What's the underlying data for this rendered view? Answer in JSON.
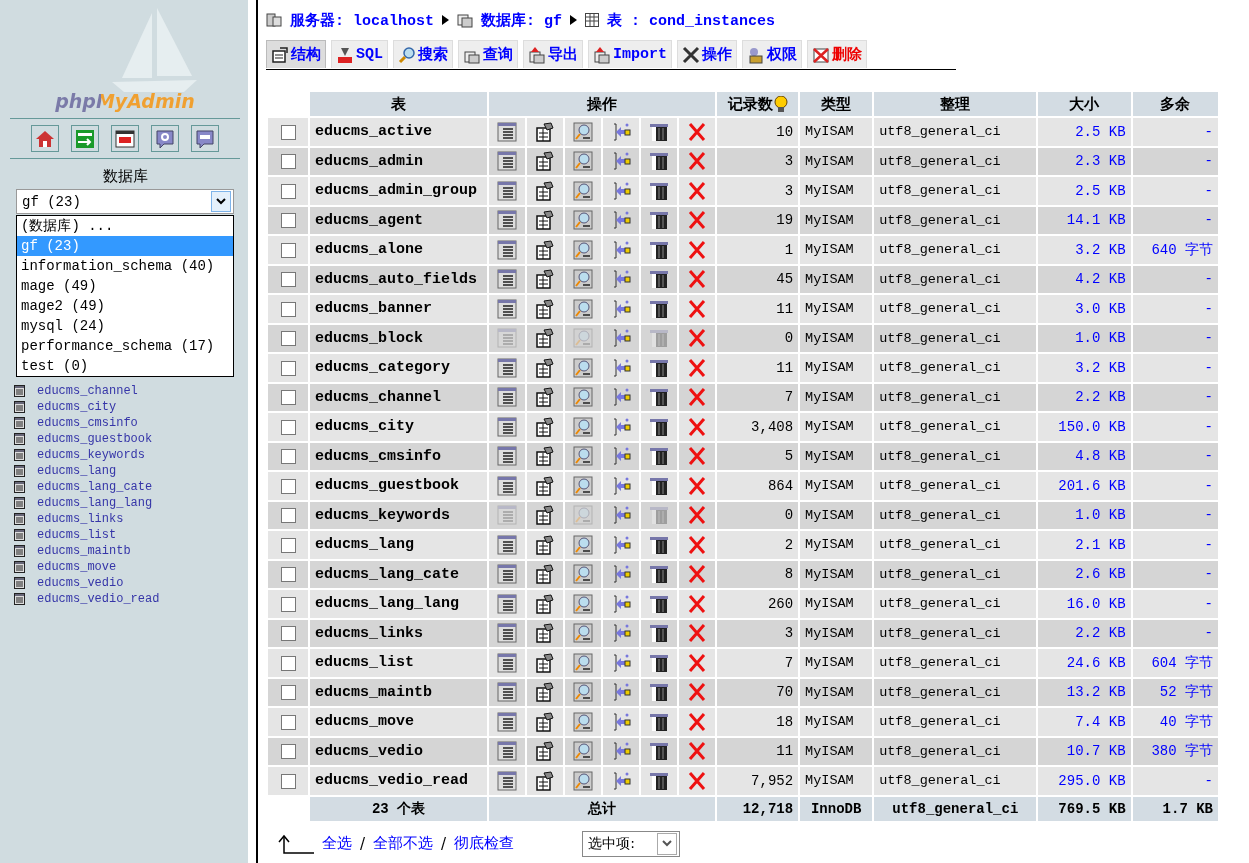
{
  "sidebar": {
    "logo": "phpMyAdmin",
    "toolbar": [
      {
        "kind": "home"
      },
      {
        "kind": "exit"
      },
      {
        "kind": "sql_window"
      },
      {
        "kind": "help"
      },
      {
        "kind": "query"
      }
    ],
    "database_label": "数据库",
    "db_select": {
      "value": "gf (23)",
      "expanded": true,
      "options": [
        {
          "label": "(数据库) ...",
          "selected": false
        },
        {
          "label": "gf (23)",
          "selected": true
        },
        {
          "label": "information_schema (40)",
          "selected": false
        },
        {
          "label": "mage (49)",
          "selected": false
        },
        {
          "label": "mage2 (49)",
          "selected": false
        },
        {
          "label": "mysql (24)",
          "selected": false
        },
        {
          "label": "performance_schema (17)",
          "selected": false
        },
        {
          "label": "test (0)",
          "selected": false
        }
      ]
    },
    "tables": [
      "educms_channel",
      "educms_city",
      "educms_cmsinfo",
      "educms_guestbook",
      "educms_keywords",
      "educms_lang",
      "educms_lang_cate",
      "educms_lang_lang",
      "educms_links",
      "educms_list",
      "educms_maintb",
      "educms_move",
      "educms_vedio",
      "educms_vedio_read"
    ]
  },
  "breadcrumb": [
    {
      "kind": "server",
      "label": "服务器: localhost"
    },
    {
      "kind": "database",
      "label": "数据库: gf"
    },
    {
      "kind": "table",
      "label": "表 : cond_instances"
    }
  ],
  "tabs": [
    {
      "kind": "structure",
      "label": "结构",
      "selected": true
    },
    {
      "kind": "sql",
      "label": "SQL",
      "selected": false
    },
    {
      "kind": "search",
      "label": "搜索",
      "selected": false
    },
    {
      "kind": "query",
      "label": "查询",
      "selected": false
    },
    {
      "kind": "export",
      "label": "导出",
      "selected": false
    },
    {
      "kind": "import",
      "label": "Import",
      "selected": false
    },
    {
      "kind": "operations",
      "label": "操作",
      "selected": false
    },
    {
      "kind": "privileges",
      "label": "权限",
      "selected": false
    },
    {
      "kind": "drop",
      "label": "删除",
      "selected": false
    }
  ],
  "table": {
    "columns": [
      "表",
      "操作",
      "记录数",
      "类型",
      "整理",
      "大小",
      "多余"
    ],
    "rows": [
      {
        "name": "educms_active",
        "checked": false,
        "empty": false,
        "records": "10",
        "type": "MyISAM",
        "collation": "utf8_general_ci",
        "size": "2.5 KB",
        "overhead": "-"
      },
      {
        "name": "educms_admin",
        "checked": false,
        "empty": false,
        "records": "3",
        "type": "MyISAM",
        "collation": "utf8_general_ci",
        "size": "2.3 KB",
        "overhead": "-"
      },
      {
        "name": "educms_admin_group",
        "checked": false,
        "empty": false,
        "records": "3",
        "type": "MyISAM",
        "collation": "utf8_general_ci",
        "size": "2.5 KB",
        "overhead": "-"
      },
      {
        "name": "educms_agent",
        "checked": false,
        "empty": false,
        "records": "19",
        "type": "MyISAM",
        "collation": "utf8_general_ci",
        "size": "14.1 KB",
        "overhead": "-"
      },
      {
        "name": "educms_alone",
        "checked": false,
        "empty": false,
        "records": "1",
        "type": "MyISAM",
        "collation": "utf8_general_ci",
        "size": "3.2 KB",
        "overhead": "640 字节"
      },
      {
        "name": "educms_auto_fields",
        "checked": false,
        "empty": false,
        "records": "45",
        "type": "MyISAM",
        "collation": "utf8_general_ci",
        "size": "4.2 KB",
        "overhead": "-"
      },
      {
        "name": "educms_banner",
        "checked": false,
        "empty": false,
        "records": "11",
        "type": "MyISAM",
        "collation": "utf8_general_ci",
        "size": "3.0 KB",
        "overhead": "-"
      },
      {
        "name": "educms_block",
        "checked": false,
        "empty": true,
        "records": "0",
        "type": "MyISAM",
        "collation": "utf8_general_ci",
        "size": "1.0 KB",
        "overhead": "-"
      },
      {
        "name": "educms_category",
        "checked": false,
        "empty": false,
        "records": "11",
        "type": "MyISAM",
        "collation": "utf8_general_ci",
        "size": "3.2 KB",
        "overhead": "-"
      },
      {
        "name": "educms_channel",
        "checked": false,
        "empty": false,
        "records": "7",
        "type": "MyISAM",
        "collation": "utf8_general_ci",
        "size": "2.2 KB",
        "overhead": "-"
      },
      {
        "name": "educms_city",
        "checked": false,
        "empty": false,
        "records": "3,408",
        "type": "MyISAM",
        "collation": "utf8_general_ci",
        "size": "150.0 KB",
        "overhead": "-"
      },
      {
        "name": "educms_cmsinfo",
        "checked": false,
        "empty": false,
        "records": "5",
        "type": "MyISAM",
        "collation": "utf8_general_ci",
        "size": "4.8 KB",
        "overhead": "-"
      },
      {
        "name": "educms_guestbook",
        "checked": false,
        "empty": false,
        "records": "864",
        "type": "MyISAM",
        "collation": "utf8_general_ci",
        "size": "201.6 KB",
        "overhead": "-"
      },
      {
        "name": "educms_keywords",
        "checked": false,
        "empty": true,
        "records": "0",
        "type": "MyISAM",
        "collation": "utf8_general_ci",
        "size": "1.0 KB",
        "overhead": "-"
      },
      {
        "name": "educms_lang",
        "checked": false,
        "empty": false,
        "records": "2",
        "type": "MyISAM",
        "collation": "utf8_general_ci",
        "size": "2.1 KB",
        "overhead": "-"
      },
      {
        "name": "educms_lang_cate",
        "checked": false,
        "empty": false,
        "records": "8",
        "type": "MyISAM",
        "collation": "utf8_general_ci",
        "size": "2.6 KB",
        "overhead": "-"
      },
      {
        "name": "educms_lang_lang",
        "checked": false,
        "empty": false,
        "records": "260",
        "type": "MyISAM",
        "collation": "utf8_general_ci",
        "size": "16.0 KB",
        "overhead": "-"
      },
      {
        "name": "educms_links",
        "checked": false,
        "empty": false,
        "records": "3",
        "type": "MyISAM",
        "collation": "utf8_general_ci",
        "size": "2.2 KB",
        "overhead": "-"
      },
      {
        "name": "educms_list",
        "checked": false,
        "empty": false,
        "records": "7",
        "type": "MyISAM",
        "collation": "utf8_general_ci",
        "size": "24.6 KB",
        "overhead": "604 字节"
      },
      {
        "name": "educms_maintb",
        "checked": false,
        "empty": false,
        "records": "70",
        "type": "MyISAM",
        "collation": "utf8_general_ci",
        "size": "13.2 KB",
        "overhead": "52 字节"
      },
      {
        "name": "educms_move",
        "checked": false,
        "empty": false,
        "records": "18",
        "type": "MyISAM",
        "collation": "utf8_general_ci",
        "size": "7.4 KB",
        "overhead": "40 字节"
      },
      {
        "name": "educms_vedio",
        "checked": false,
        "empty": false,
        "records": "11",
        "type": "MyISAM",
        "collation": "utf8_general_ci",
        "size": "10.7 KB",
        "overhead": "380 字节"
      },
      {
        "name": "educms_vedio_read",
        "checked": false,
        "empty": false,
        "records": "7,952",
        "type": "MyISAM",
        "collation": "utf8_general_ci",
        "size": "295.0 KB",
        "overhead": "-"
      }
    ],
    "footer": {
      "count": "23 个表",
      "label": "总计",
      "records": "12,718",
      "type": "InnoDB",
      "collation": "utf8_general_ci",
      "size": "769.5 KB",
      "overhead": "1.7 KB"
    }
  },
  "bulk": {
    "links": [
      "全选",
      "全部不选",
      "彻底检查"
    ],
    "separator": "/",
    "select_value": "选中项:"
  }
}
